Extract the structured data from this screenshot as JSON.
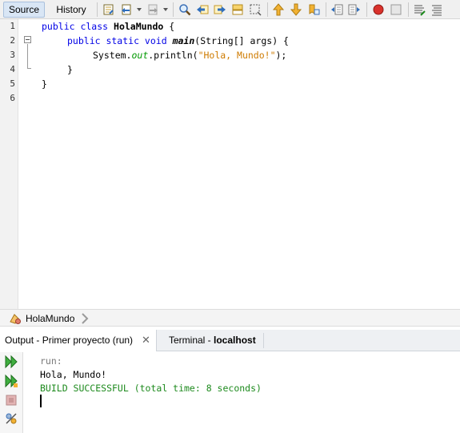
{
  "toolbar": {
    "source_label": "Source",
    "history_label": "History",
    "icons": [
      "last-edit-icon",
      "back-icon",
      "forward-icon",
      "find-icon",
      "find-previous-icon",
      "find-next-icon",
      "toggle-highlight-icon",
      "toggle-rect-select-icon",
      "previous-bookmark-icon",
      "next-bookmark-icon",
      "toggle-bookmark-icon",
      "shift-left-icon",
      "shift-right-icon",
      "start-macro-icon",
      "stop-macro-icon",
      "comment-icon",
      "uncomment-icon"
    ]
  },
  "editor": {
    "line_numbers": [
      "1",
      "2",
      "3",
      "4",
      "5",
      "6"
    ],
    "lines": [
      [
        "public class ",
        "HolaMundo",
        " {"
      ],
      [
        "public static void ",
        "main",
        "(String[] args) {"
      ],
      [
        "System.",
        "out",
        ".println(",
        "\"Hola, Mundo!\"",
        ");"
      ],
      [
        "}"
      ],
      [
        "}"
      ],
      []
    ]
  },
  "breadcrumb": {
    "label": "HolaMundo"
  },
  "output": {
    "tabs": [
      {
        "label": "Output - Primer proyecto (run)",
        "close": "✕"
      },
      {
        "label_prefix": "Terminal - ",
        "label_bold": "localhost"
      }
    ],
    "lines": [
      "run:",
      "Hola, Mundo!",
      "BUILD SUCCESSFUL (total time: 8 seconds)"
    ],
    "colors": {
      "success": "#1d8a1d",
      "muted": "#7a7a7a"
    }
  }
}
